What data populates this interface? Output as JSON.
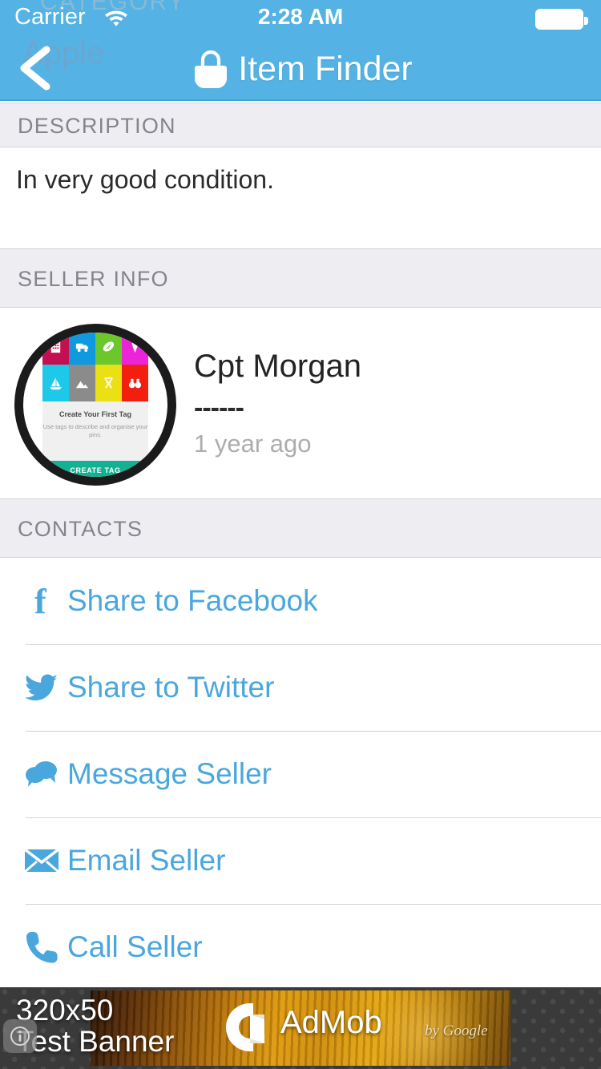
{
  "status_bar": {
    "carrier": "Carrier",
    "time": "2:28 AM",
    "wifi_icon": "wifi-icon",
    "battery_icon": "battery-full-icon"
  },
  "nav_bar": {
    "back_label": "Apple",
    "ghost_section_label": "CATEGORY",
    "title": "Item Finder",
    "logo_icon": "shopping-bag-icon",
    "back_icon": "chevron-left-icon",
    "background_color": "#54b3e4"
  },
  "sections": {
    "description": {
      "header": "DESCRIPTION",
      "body": "In very good condition."
    },
    "seller_info": {
      "header": "SELLER INFO",
      "name": "Cpt Morgan",
      "detail": "------",
      "timestamp": "1 year ago",
      "avatar": {
        "alt": "seller-avatar",
        "title": "Create Your First Tag",
        "subtitle": "Use tags to describe and organise your pins.",
        "button_label": "CREATE TAG",
        "button_color": "#13b192",
        "tiles": [
          {
            "name": "building-icon",
            "color": "#c40f52"
          },
          {
            "name": "truck-icon",
            "color": "#0f9ae0"
          },
          {
            "name": "football-icon",
            "color": "#6cc72c"
          },
          {
            "name": "ice-cream-icon",
            "color": "#ec24d8"
          },
          {
            "name": "sailboat-icon",
            "color": "#1ec8e8"
          },
          {
            "name": "mountain-icon",
            "color": "#8b8b8b"
          },
          {
            "name": "director-chair-icon",
            "color": "#ebe014"
          },
          {
            "name": "binoculars-icon",
            "color": "#f21f10"
          }
        ]
      }
    },
    "contacts": {
      "header": "CONTACTS",
      "link_color": "#4aa7de",
      "items": [
        {
          "label": "Share to Facebook",
          "icon": "facebook-icon"
        },
        {
          "label": "Share to Twitter",
          "icon": "twitter-icon"
        },
        {
          "label": "Message Seller",
          "icon": "message-bubbles-icon"
        },
        {
          "label": "Email Seller",
          "icon": "envelope-icon"
        },
        {
          "label": "Call Seller",
          "icon": "phone-icon"
        }
      ]
    }
  },
  "ad_banner": {
    "line1": "320x50",
    "line2": "Test Banner",
    "brand": "AdMob",
    "brand_suffix": "by Google",
    "info_icon": "info-icon"
  }
}
